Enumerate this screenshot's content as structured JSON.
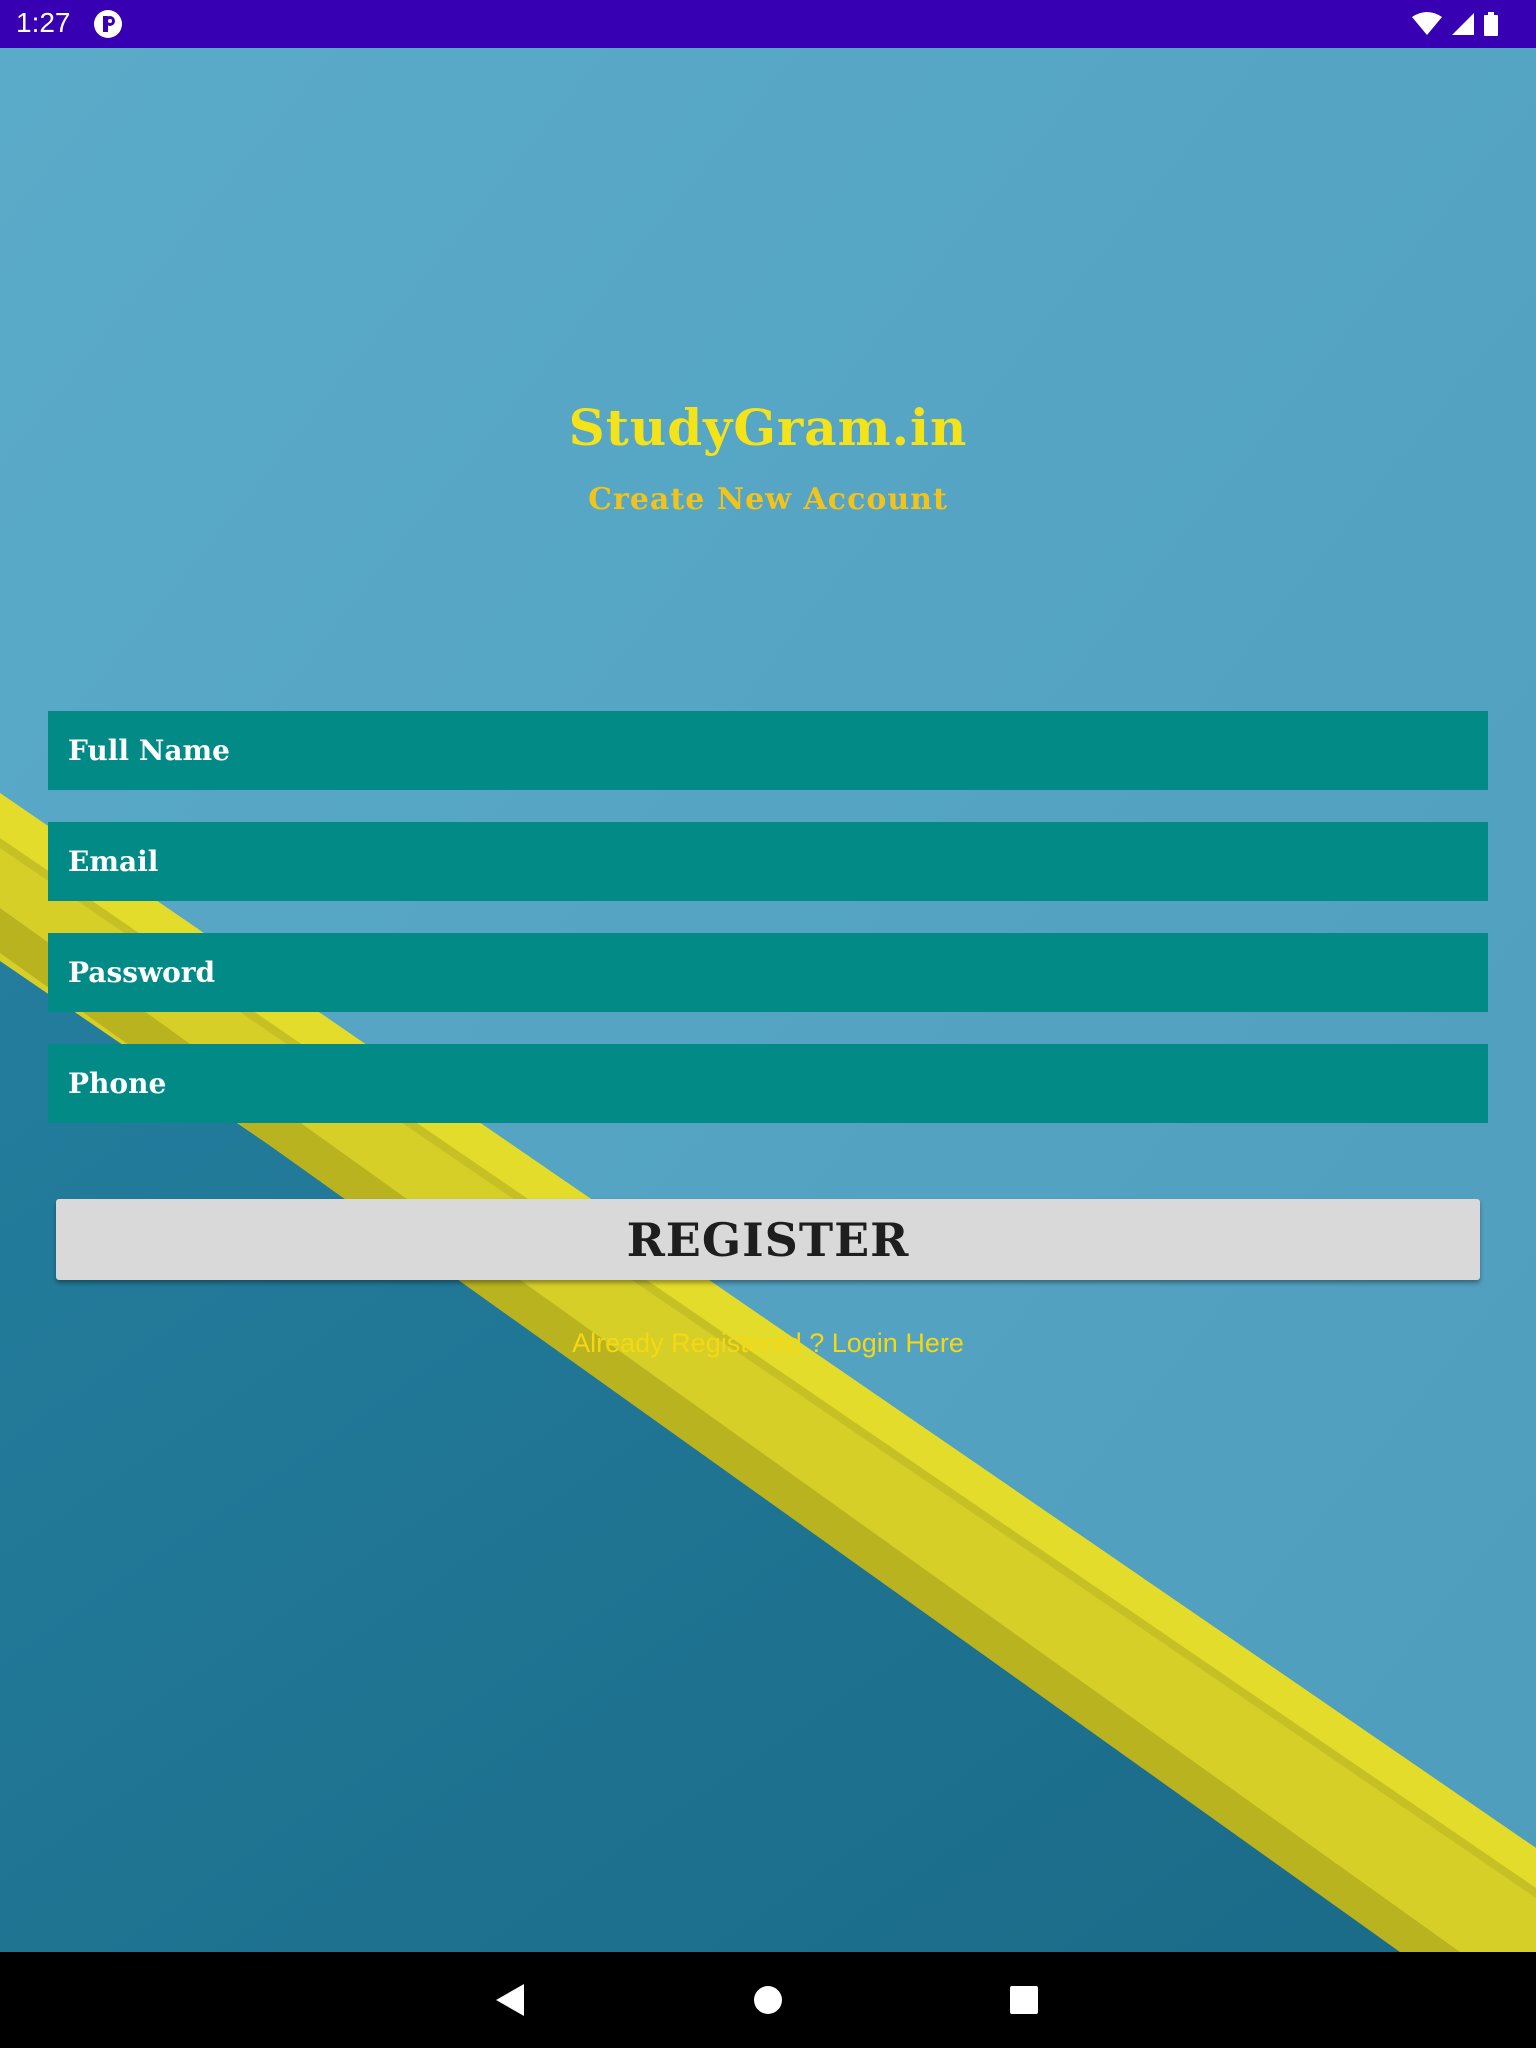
{
  "status_bar": {
    "time": "1:27",
    "app_icon": "app-notification-icon",
    "icons": [
      "wifi-icon",
      "cell-signal-icon",
      "battery-icon"
    ],
    "color": "#3700b3"
  },
  "header": {
    "title": "StudyGram.in",
    "subtitle": "Create New Account"
  },
  "form": {
    "fields": [
      {
        "placeholder": "Full Name"
      },
      {
        "placeholder": "Email"
      },
      {
        "placeholder": "Password"
      },
      {
        "placeholder": "Phone"
      }
    ],
    "field_color": "#028a87"
  },
  "register_button": {
    "label": "REGISTER"
  },
  "login_link": {
    "text": "Already Registered ? Login Here"
  },
  "nav_bar": {
    "buttons": [
      "back-icon",
      "home-icon",
      "recents-icon"
    ]
  },
  "colors": {
    "accent_yellow": "#f5e31a",
    "background_blue": "#5ba9c9",
    "background_dark_blue": "#1f7594"
  }
}
